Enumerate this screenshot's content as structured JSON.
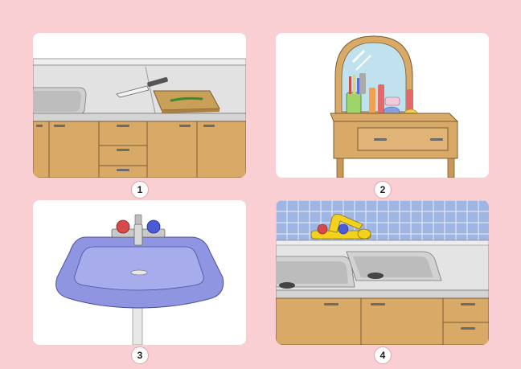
{
  "panels": [
    {
      "number": "1",
      "illustration": "kitchen-counter-with-knife-and-cutting-board"
    },
    {
      "number": "2",
      "illustration": "dressing-table-with-mirror-and-cosmetics"
    },
    {
      "number": "3",
      "illustration": "bathroom-pedestal-sink"
    },
    {
      "number": "4",
      "illustration": "kitchen-double-sink-with-tiles"
    }
  ],
  "colors": {
    "background": "#f9cfd4",
    "card": "#ffffff",
    "wood": "#d9a967",
    "counter": "#e4e4e4",
    "sink_blue": "#8f95e0",
    "tile_blue": "#9fb6e4",
    "faucet_yellow": "#f3d21d"
  }
}
